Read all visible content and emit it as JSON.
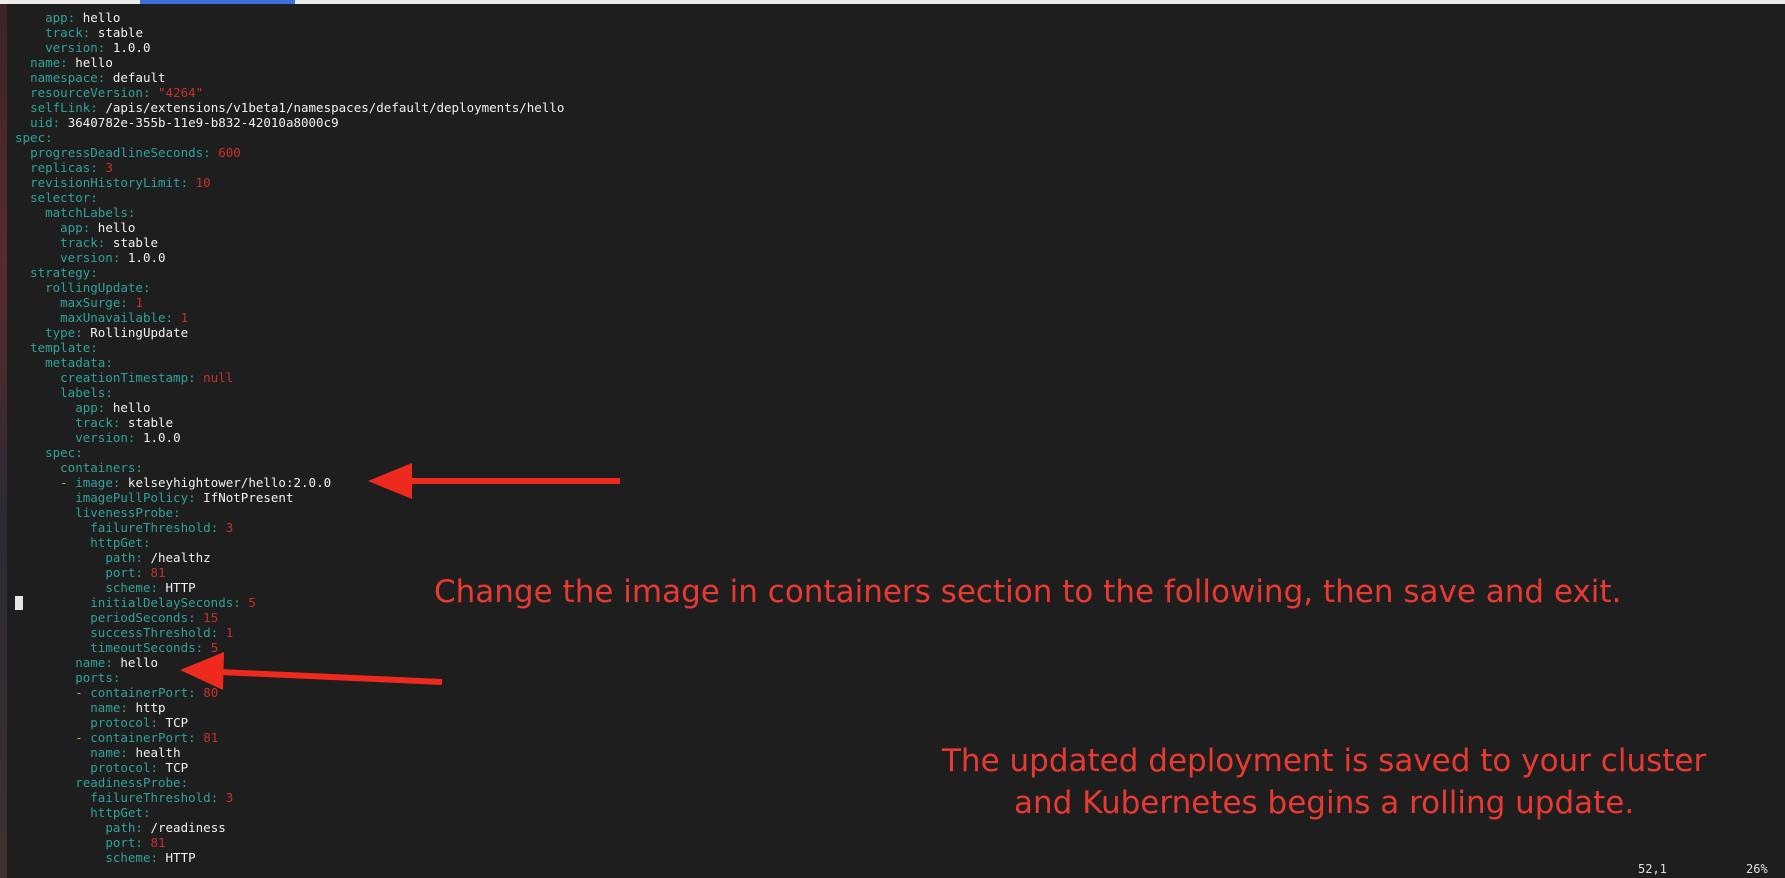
{
  "editor": {
    "lines": [
      [
        {
          "t": "    "
        },
        {
          "k": "app"
        },
        {
          "p": ": "
        },
        {
          "v": "hello"
        }
      ],
      [
        {
          "t": "    "
        },
        {
          "k": "track"
        },
        {
          "p": ": "
        },
        {
          "v": "stable"
        }
      ],
      [
        {
          "t": "    "
        },
        {
          "k": "version"
        },
        {
          "p": ": "
        },
        {
          "v": "1.0.0"
        }
      ],
      [
        {
          "t": "  "
        },
        {
          "k": "name"
        },
        {
          "p": ": "
        },
        {
          "v": "hello"
        }
      ],
      [
        {
          "t": "  "
        },
        {
          "k": "namespace"
        },
        {
          "p": ": "
        },
        {
          "v": "default"
        }
      ],
      [
        {
          "t": "  "
        },
        {
          "k": "resourceVersion"
        },
        {
          "p": ": "
        },
        {
          "n": "\"4264\""
        }
      ],
      [
        {
          "t": "  "
        },
        {
          "k": "selfLink"
        },
        {
          "p": ": "
        },
        {
          "v": "/apis/extensions/v1beta1/namespaces/default/deployments/hello"
        }
      ],
      [
        {
          "t": "  "
        },
        {
          "k": "uid"
        },
        {
          "p": ": "
        },
        {
          "v": "3640782e-355b-11e9-b832-42010a8000c9"
        }
      ],
      [
        {
          "k": "spec"
        },
        {
          "p": ":"
        }
      ],
      [
        {
          "t": "  "
        },
        {
          "k": "progressDeadlineSeconds"
        },
        {
          "p": ": "
        },
        {
          "n": "600"
        }
      ],
      [
        {
          "t": "  "
        },
        {
          "k": "replicas"
        },
        {
          "p": ": "
        },
        {
          "n": "3"
        }
      ],
      [
        {
          "t": "  "
        },
        {
          "k": "revisionHistoryLimit"
        },
        {
          "p": ": "
        },
        {
          "n": "10"
        }
      ],
      [
        {
          "t": "  "
        },
        {
          "k": "selector"
        },
        {
          "p": ":"
        }
      ],
      [
        {
          "t": "    "
        },
        {
          "k": "matchLabels"
        },
        {
          "p": ":"
        }
      ],
      [
        {
          "t": "      "
        },
        {
          "k": "app"
        },
        {
          "p": ": "
        },
        {
          "v": "hello"
        }
      ],
      [
        {
          "t": "      "
        },
        {
          "k": "track"
        },
        {
          "p": ": "
        },
        {
          "v": "stable"
        }
      ],
      [
        {
          "t": "      "
        },
        {
          "k": "version"
        },
        {
          "p": ": "
        },
        {
          "v": "1.0.0"
        }
      ],
      [
        {
          "t": "  "
        },
        {
          "k": "strategy"
        },
        {
          "p": ":"
        }
      ],
      [
        {
          "t": "    "
        },
        {
          "k": "rollingUpdate"
        },
        {
          "p": ":"
        }
      ],
      [
        {
          "t": "      "
        },
        {
          "k": "maxSurge"
        },
        {
          "p": ": "
        },
        {
          "n": "1"
        }
      ],
      [
        {
          "t": "      "
        },
        {
          "k": "maxUnavailable"
        },
        {
          "p": ": "
        },
        {
          "n": "1"
        }
      ],
      [
        {
          "t": "    "
        },
        {
          "k": "type"
        },
        {
          "p": ": "
        },
        {
          "v": "RollingUpdate"
        }
      ],
      [
        {
          "t": "  "
        },
        {
          "k": "template"
        },
        {
          "p": ":"
        }
      ],
      [
        {
          "t": "    "
        },
        {
          "k": "metadata"
        },
        {
          "p": ":"
        }
      ],
      [
        {
          "t": "      "
        },
        {
          "k": "creationTimestamp"
        },
        {
          "p": ": "
        },
        {
          "n": "null"
        }
      ],
      [
        {
          "t": "      "
        },
        {
          "k": "labels"
        },
        {
          "p": ":"
        }
      ],
      [
        {
          "t": "        "
        },
        {
          "k": "app"
        },
        {
          "p": ": "
        },
        {
          "v": "hello"
        }
      ],
      [
        {
          "t": "        "
        },
        {
          "k": "track"
        },
        {
          "p": ": "
        },
        {
          "v": "stable"
        }
      ],
      [
        {
          "t": "        "
        },
        {
          "k": "version"
        },
        {
          "p": ": "
        },
        {
          "v": "1.0.0"
        }
      ],
      [
        {
          "t": "    "
        },
        {
          "k": "spec"
        },
        {
          "p": ":"
        }
      ],
      [
        {
          "t": "      "
        },
        {
          "k": "containers"
        },
        {
          "p": ":"
        }
      ],
      [
        {
          "t": "      "
        },
        {
          "d": "- "
        },
        {
          "k": "image"
        },
        {
          "p": ": "
        },
        {
          "v": "kelseyhightower/hello:2.0.0"
        }
      ],
      [
        {
          "t": "        "
        },
        {
          "k": "imagePullPolicy"
        },
        {
          "p": ": "
        },
        {
          "v": "IfNotPresent"
        }
      ],
      [
        {
          "t": "        "
        },
        {
          "k": "livenessProbe"
        },
        {
          "p": ":"
        }
      ],
      [
        {
          "t": "          "
        },
        {
          "k": "failureThreshold"
        },
        {
          "p": ": "
        },
        {
          "n": "3"
        }
      ],
      [
        {
          "t": "          "
        },
        {
          "k": "httpGet"
        },
        {
          "p": ":"
        }
      ],
      [
        {
          "t": "            "
        },
        {
          "k": "path"
        },
        {
          "p": ": "
        },
        {
          "v": "/healthz"
        }
      ],
      [
        {
          "t": "            "
        },
        {
          "k": "port"
        },
        {
          "p": ": "
        },
        {
          "n": "81"
        }
      ],
      [
        {
          "t": "            "
        },
        {
          "k": "scheme"
        },
        {
          "p": ": "
        },
        {
          "v": "HTTP"
        }
      ],
      [
        {
          "t": "          "
        },
        {
          "k": "initialDelaySeconds"
        },
        {
          "p": ": "
        },
        {
          "n": "5"
        }
      ],
      [
        {
          "t": "          "
        },
        {
          "k": "periodSeconds"
        },
        {
          "p": ": "
        },
        {
          "n": "15"
        }
      ],
      [
        {
          "t": "          "
        },
        {
          "k": "successThreshold"
        },
        {
          "p": ": "
        },
        {
          "n": "1"
        }
      ],
      [
        {
          "t": "          "
        },
        {
          "k": "timeoutSeconds"
        },
        {
          "p": ": "
        },
        {
          "n": "5"
        }
      ],
      [
        {
          "t": "        "
        },
        {
          "k": "name"
        },
        {
          "p": ": "
        },
        {
          "v": "hello"
        }
      ],
      [
        {
          "t": "        "
        },
        {
          "k": "ports"
        },
        {
          "p": ":"
        }
      ],
      [
        {
          "t": "        "
        },
        {
          "d": "- "
        },
        {
          "k": "containerPort"
        },
        {
          "p": ": "
        },
        {
          "n": "80"
        }
      ],
      [
        {
          "t": "          "
        },
        {
          "k": "name"
        },
        {
          "p": ": "
        },
        {
          "v": "http"
        }
      ],
      [
        {
          "t": "          "
        },
        {
          "k": "protocol"
        },
        {
          "p": ": "
        },
        {
          "v": "TCP"
        }
      ],
      [
        {
          "t": "        "
        },
        {
          "d": "- "
        },
        {
          "k": "containerPort"
        },
        {
          "p": ": "
        },
        {
          "n": "81"
        }
      ],
      [
        {
          "t": "          "
        },
        {
          "k": "name"
        },
        {
          "p": ": "
        },
        {
          "v": "health"
        }
      ],
      [
        {
          "t": "          "
        },
        {
          "k": "protocol"
        },
        {
          "p": ": "
        },
        {
          "v": "TCP"
        }
      ],
      [
        {
          "t": "        "
        },
        {
          "k": "readinessProbe"
        },
        {
          "p": ":"
        }
      ],
      [
        {
          "t": "          "
        },
        {
          "k": "failureThreshold"
        },
        {
          "p": ": "
        },
        {
          "n": "3"
        }
      ],
      [
        {
          "t": "          "
        },
        {
          "k": "httpGet"
        },
        {
          "p": ":"
        }
      ],
      [
        {
          "t": "            "
        },
        {
          "k": "path"
        },
        {
          "p": ": "
        },
        {
          "v": "/readiness"
        }
      ],
      [
        {
          "t": "            "
        },
        {
          "k": "port"
        },
        {
          "p": ": "
        },
        {
          "n": "81"
        }
      ],
      [
        {
          "t": "            "
        },
        {
          "k": "scheme"
        },
        {
          "p": ": "
        },
        {
          "v": "HTTP"
        }
      ]
    ]
  },
  "annotations": {
    "first": "Change the image in containers section to the following, then save and exit.",
    "second_line1": "The updated deployment is saved to your cluster",
    "second_line2": "and Kubernetes begins a rolling update."
  },
  "status": {
    "position": "52,1",
    "percent": "26%"
  },
  "colors": {
    "background": "#1e1e1e",
    "key": "#2fa39b",
    "number": "#c4322c",
    "value": "#f2f2f2",
    "dash": "#d9a23a",
    "annotation": "#e83a32"
  }
}
